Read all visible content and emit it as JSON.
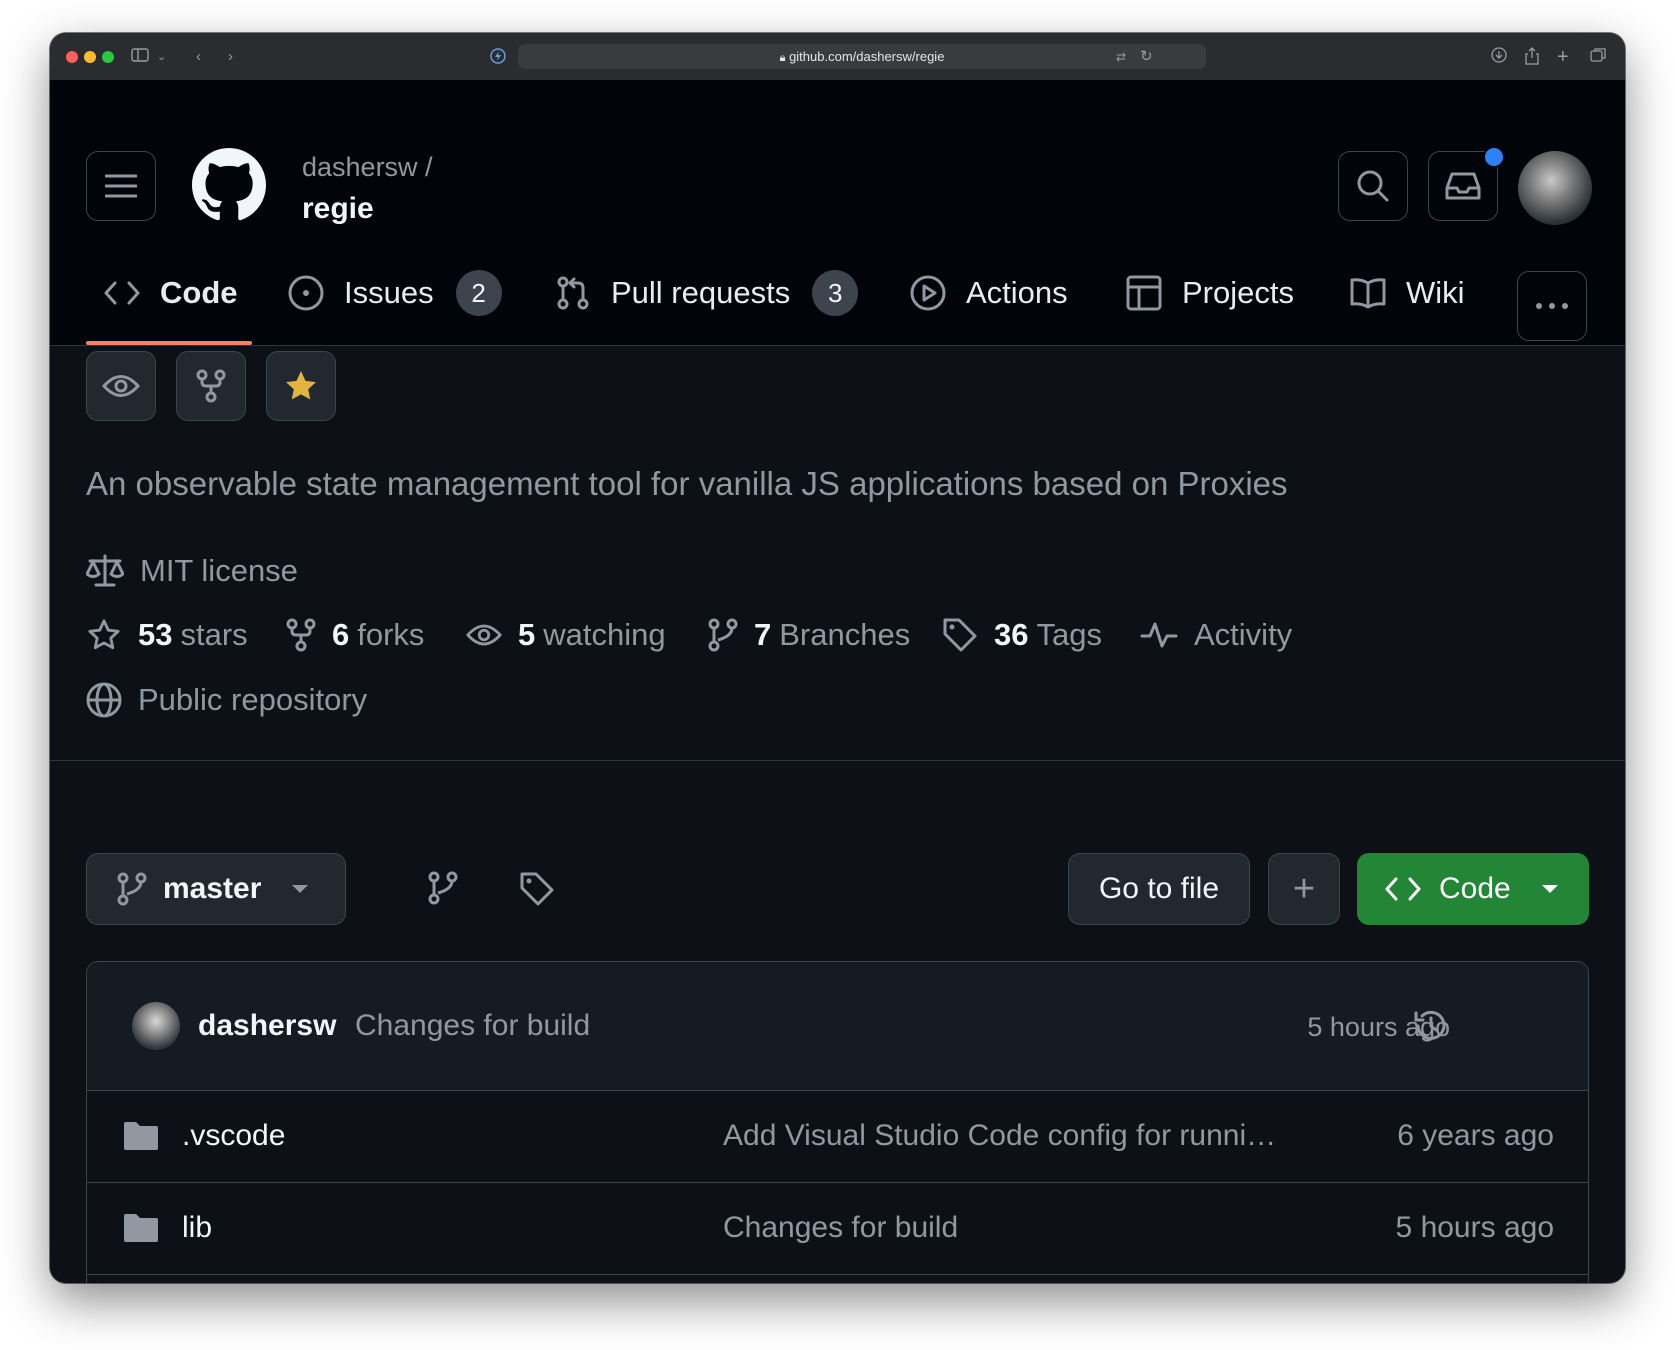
{
  "browser": {
    "url": "github.com/dashersw/regie"
  },
  "header": {
    "owner": "dashersw /",
    "repo": "regie"
  },
  "tabs": [
    {
      "label": "Code",
      "icon": "code-icon",
      "active": true
    },
    {
      "label": "Issues",
      "icon": "issue-icon",
      "count": "2"
    },
    {
      "label": "Pull requests",
      "icon": "pull-request-icon",
      "count": "3"
    },
    {
      "label": "Actions",
      "icon": "play-icon"
    },
    {
      "label": "Projects",
      "icon": "table-icon"
    },
    {
      "label": "Wiki",
      "icon": "book-icon"
    }
  ],
  "about": {
    "description": "An observable state management tool for vanilla JS applications based on Proxies",
    "license": "MIT license",
    "stars_count": "53",
    "stars_label": "stars",
    "forks_count": "6",
    "forks_label": "forks",
    "watching_count": "5",
    "watching_label": "watching",
    "branches_count": "7",
    "branches_label": "Branches",
    "tags_count": "36",
    "tags_label": "Tags",
    "activity": "Activity",
    "visibility": "Public repository"
  },
  "toolbar": {
    "branch": "master",
    "go_to_file": "Go to file",
    "add": "+",
    "code": "Code"
  },
  "latest_commit": {
    "author": "dashersw",
    "message": "Changes for build",
    "time": "5 hours ago"
  },
  "files": [
    {
      "name": ".vscode",
      "message": "Add Visual Studio Code config for runni…",
      "age": "6 years ago"
    },
    {
      "name": "lib",
      "message": "Changes for build",
      "age": "5 hours ago"
    }
  ],
  "colors": {
    "accent_underline": "#f78166",
    "code_button": "#238636",
    "star": "#e3b341",
    "notification": "#2f81f7"
  }
}
